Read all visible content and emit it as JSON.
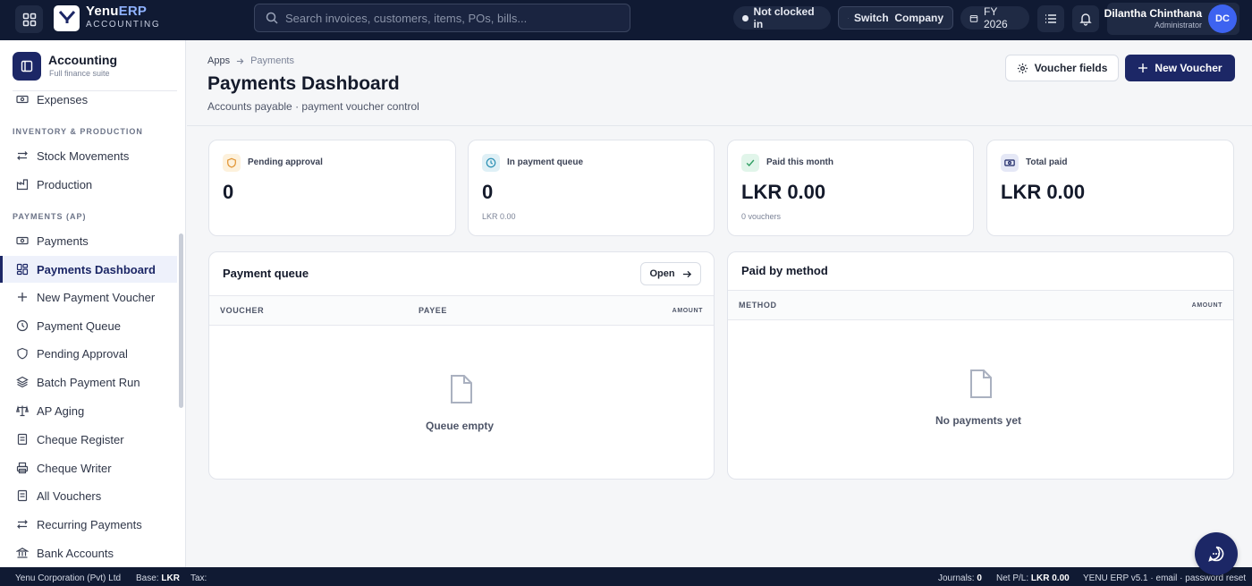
{
  "topbar": {
    "brand_name_a": "Yenu",
    "brand_name_b": "ERP",
    "brand_sub": "ACCOUNTING",
    "logo_text": "Yenu",
    "search_placeholder": "Search invoices, customers, items, POs, bills...",
    "clock_status": "Not clocked in",
    "switch_label": "Switch  Company",
    "fy_label": "FY 2026",
    "user_name": "Dilantha Chinthana",
    "user_role": "Administrator",
    "user_initials": "DC"
  },
  "sidebar": {
    "app_title": "Accounting",
    "app_subtitle": "Full finance suite",
    "top_item": "Expenses",
    "section_inventory": "INVENTORY & PRODUCTION",
    "inventory_items": [
      "Stock Movements",
      "Production"
    ],
    "section_payments": "PAYMENTS (AP)",
    "payment_items": [
      "Payments",
      "Payments Dashboard",
      "New Payment Voucher",
      "Payment Queue",
      "Pending Approval",
      "Batch Payment Run",
      "AP Aging",
      "Cheque Register",
      "Cheque Writer",
      "All Vouchers",
      "Recurring Payments",
      "Bank Accounts"
    ],
    "active_item": "Payments Dashboard"
  },
  "header": {
    "breadcrumb": [
      "Apps",
      "Payments"
    ],
    "title": "Payments Dashboard",
    "subtitle": "Accounts payable · payment voucher control",
    "btn_fields": "Voucher fields",
    "btn_new": "New Voucher"
  },
  "stats": [
    {
      "label": "Pending approval",
      "value": "0",
      "foot": ""
    },
    {
      "label": "In payment queue",
      "value": "0",
      "foot": "LKR 0.00"
    },
    {
      "label": "Paid this month",
      "value": "LKR 0.00",
      "foot": "0 vouchers"
    },
    {
      "label": "Total paid",
      "value": "LKR 0.00",
      "foot": ""
    }
  ],
  "queue": {
    "title": "Payment queue",
    "open_label": "Open",
    "cols": [
      "VOUCHER",
      "PAYEE",
      "AMOUNT"
    ],
    "empty": "Queue empty"
  },
  "method": {
    "title": "Paid by method",
    "cols": [
      "METHOD",
      "AMOUNT"
    ],
    "empty": "No payments yet"
  },
  "statusbar": {
    "company": "Yenu Corporation (Pvt) Ltd",
    "base_label": "Base:",
    "base_value": "LKR",
    "tax_label": "Tax:",
    "journals_label": "Journals:",
    "journals_value": "0",
    "pl_label": "Net P/L:",
    "pl_value": "LKR 0.00",
    "version": "YENU ERP v5.1 · email · password reset"
  },
  "colors": {
    "navy": "#101a33",
    "brand": "#1c2766",
    "accent": "#3d63f0"
  }
}
